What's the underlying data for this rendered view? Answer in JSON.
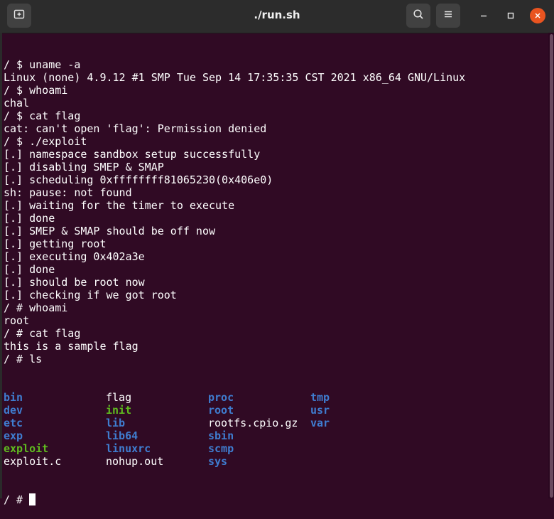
{
  "window": {
    "title": "./run.sh"
  },
  "icons": {
    "new_tab": "new-tab-icon",
    "search": "search-icon",
    "menu": "hamburger-menu-icon",
    "minimize": "minimize-icon",
    "maximize": "maximize-icon",
    "close": "close-icon"
  },
  "colors": {
    "background": "#300a24",
    "text": "#ffffff",
    "directory": "#3f7dd0",
    "executable": "#5fba1f",
    "close_button": "#e95420"
  },
  "terminal": {
    "lines": [
      "/ $ uname -a",
      "Linux (none) 4.9.12 #1 SMP Tue Sep 14 17:35:35 CST 2021 x86_64 GNU/Linux",
      "/ $ whoami",
      "chal",
      "/ $ cat flag",
      "cat: can't open 'flag': Permission denied",
      "/ $ ./exploit",
      "[.] namespace sandbox setup successfully",
      "[.] disabling SMEP & SMAP",
      "[.] scheduling 0xffffffff81065230(0x406e0)",
      "sh: pause: not found",
      "[.] waiting for the timer to execute",
      "[.] done",
      "[.] SMEP & SMAP should be off now",
      "[.] getting root",
      "[.] executing 0x402a3e",
      "[.] done",
      "[.] should be root now",
      "[.] checking if we got root",
      "/ # whoami",
      "root",
      "/ # cat flag",
      "this is a sample flag",
      "/ # ls"
    ],
    "ls_rows": [
      [
        {
          "text": "bin",
          "type": "dir"
        },
        {
          "text": "flag",
          "type": "file"
        },
        {
          "text": "proc",
          "type": "dir"
        },
        {
          "text": "tmp",
          "type": "dir"
        }
      ],
      [
        {
          "text": "dev",
          "type": "dir"
        },
        {
          "text": "init",
          "type": "exec"
        },
        {
          "text": "root",
          "type": "dir"
        },
        {
          "text": "usr",
          "type": "dir"
        }
      ],
      [
        {
          "text": "etc",
          "type": "dir"
        },
        {
          "text": "lib",
          "type": "dir"
        },
        {
          "text": "rootfs.cpio.gz",
          "type": "file"
        },
        {
          "text": "var",
          "type": "dir"
        }
      ],
      [
        {
          "text": "exp",
          "type": "dir"
        },
        {
          "text": "lib64",
          "type": "dir"
        },
        {
          "text": "sbin",
          "type": "dir"
        }
      ],
      [
        {
          "text": "exploit",
          "type": "exec"
        },
        {
          "text": "linuxrc",
          "type": "dir"
        },
        {
          "text": "scmp",
          "type": "dir"
        }
      ],
      [
        {
          "text": "exploit.c",
          "type": "file"
        },
        {
          "text": "nohup.out",
          "type": "file"
        },
        {
          "text": "sys",
          "type": "dir"
        }
      ]
    ],
    "prompt": "/ # "
  }
}
